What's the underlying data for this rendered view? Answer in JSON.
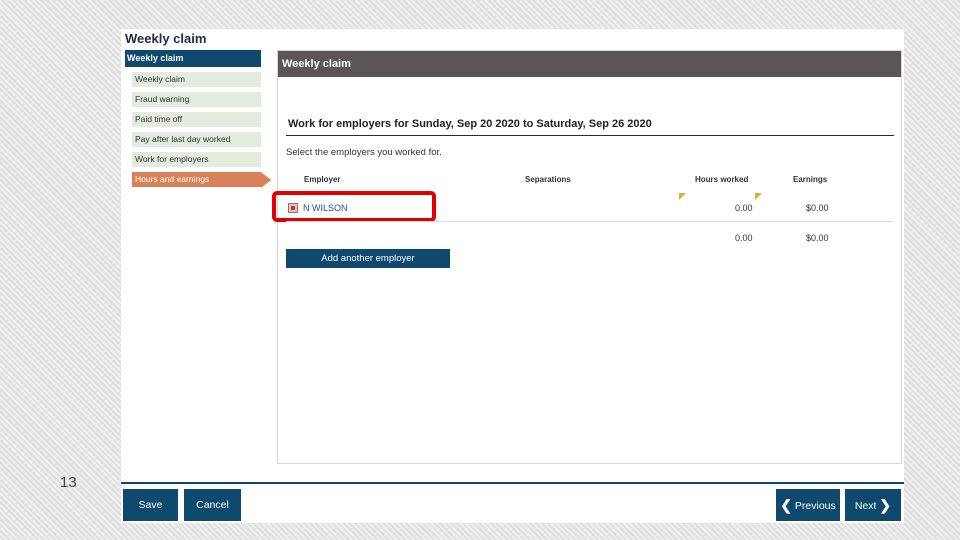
{
  "slide": {
    "number": "13"
  },
  "app": {
    "title": "Weekly claim"
  },
  "sidebar": {
    "header": "Weekly claim",
    "items": [
      {
        "label": "Weekly claim"
      },
      {
        "label": "Fraud warning"
      },
      {
        "label": "Paid time off"
      },
      {
        "label": "Pay after last day worked"
      },
      {
        "label": "Work for employers"
      },
      {
        "label": "Hours and earnings",
        "active": true
      }
    ]
  },
  "panel": {
    "header": "Weekly claim",
    "section_title": "Work for employers for Sunday, Sep 20 2020 to Saturday, Sep 26 2020",
    "instruction": "Select the employers you worked for.",
    "columns": {
      "employer": "Employer",
      "separations": "Separations",
      "hours": "Hours worked",
      "earnings": "Earnings"
    },
    "rows": [
      {
        "employer": "N WILSON",
        "hours": "0.00",
        "earnings": "$0.00"
      }
    ],
    "totals": {
      "hours": "0.00",
      "earnings": "$0.00"
    },
    "add_button": "Add another employer"
  },
  "footer": {
    "save": "Save",
    "cancel": "Cancel",
    "previous": "Previous",
    "next": "Next"
  },
  "colors": {
    "primary": "#0f4a6e",
    "active_step": "#d98158",
    "highlight": "#e00000",
    "panel_header": "#5a5655"
  }
}
